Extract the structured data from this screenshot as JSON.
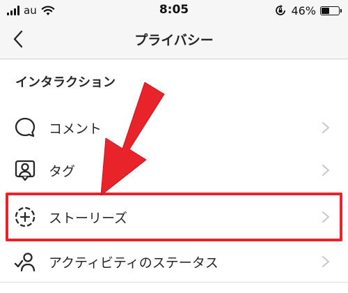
{
  "status_bar": {
    "carrier": "au",
    "time": "8:05",
    "battery_percent": "46%",
    "battery_level": 0.46
  },
  "nav": {
    "title": "プライバシー",
    "back_icon": "chevron-left-icon"
  },
  "section": {
    "header": "インタラクション"
  },
  "menu_items": [
    {
      "label": "コメント",
      "icon": "comment-bubble-icon"
    },
    {
      "label": "タグ",
      "icon": "tag-person-icon"
    },
    {
      "label": "ストーリーズ",
      "icon": "story-add-icon",
      "highlighted": true
    },
    {
      "label": "アクティビティのステータス",
      "icon": "activity-status-icon"
    }
  ],
  "colors": {
    "annotation_red": "#e8232a",
    "bar_background": "#f6f6f6",
    "text": "#262626",
    "chevron": "#c7c7cc"
  }
}
